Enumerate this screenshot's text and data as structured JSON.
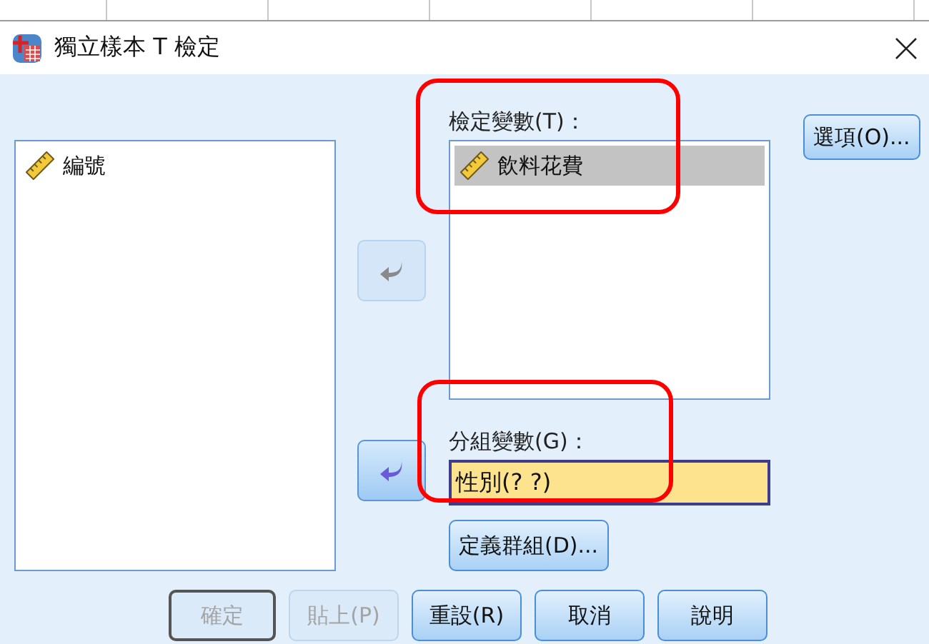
{
  "window": {
    "title": "獨立樣本 T 檢定"
  },
  "source_list": {
    "items": [
      {
        "label": "編號",
        "selected": false
      }
    ]
  },
  "arrows": [
    {
      "disabled": true
    },
    {
      "disabled": false
    }
  ],
  "test_variables": {
    "label": "檢定變數(T)：",
    "highlighted": true,
    "items": [
      {
        "label": "飲料花費",
        "selected": true
      }
    ]
  },
  "grouping_variable": {
    "label": "分組變數(G)：",
    "highlighted": true,
    "value": "性別(? ?)"
  },
  "define_groups_button": {
    "label": "定義群組(D)...",
    "disabled": false
  },
  "options_button": {
    "label": "選項(O)...",
    "disabled": false
  },
  "buttons": [
    {
      "label": "確定",
      "disabled": true,
      "default": true
    },
    {
      "label": "貼上(P)",
      "disabled": true,
      "default": false
    },
    {
      "label": "重設(R)",
      "disabled": false,
      "default": false
    },
    {
      "label": "取消",
      "disabled": false,
      "default": false
    },
    {
      "label": "說明",
      "disabled": false,
      "default": false
    }
  ]
}
